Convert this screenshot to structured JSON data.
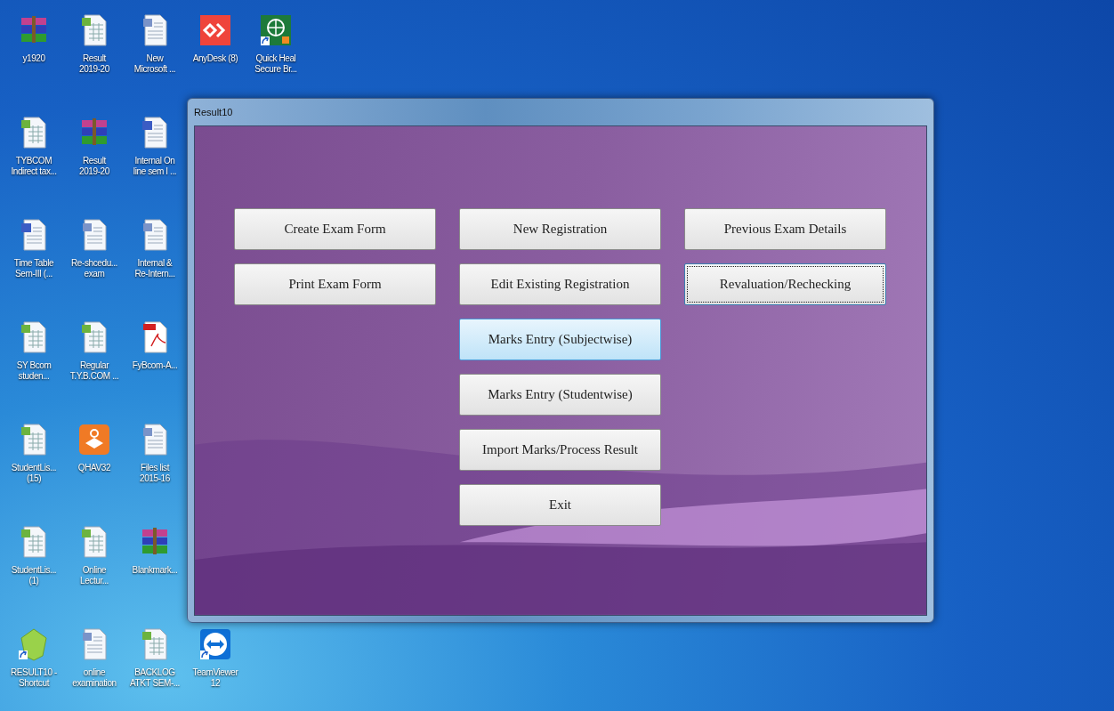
{
  "desktop_icons": [
    [
      {
        "label": "y1920",
        "kind": "archive",
        "shortcut": false
      },
      {
        "label": "Result\n2019-20",
        "kind": "excel",
        "shortcut": false
      },
      {
        "label": "New\nMicrosoft ...",
        "kind": "word-doc",
        "shortcut": false
      },
      {
        "label": "AnyDesk (8)",
        "kind": "anydesk",
        "shortcut": false
      },
      {
        "label": "Quick Heal\nSecure Br...",
        "kind": "globe",
        "shortcut": true
      }
    ],
    [
      {
        "label": "TYBCOM\nIndirect tax...",
        "kind": "excel",
        "shortcut": false
      },
      {
        "label": "Result\n2019-20",
        "kind": "archive",
        "shortcut": false
      },
      {
        "label": "Internal On\nline sem I ...",
        "kind": "word",
        "shortcut": false
      }
    ],
    [
      {
        "label": "Time Table\nSem-III (...",
        "kind": "word",
        "shortcut": false
      },
      {
        "label": "Re-shcedu...\nexam",
        "kind": "word-doc",
        "shortcut": false
      },
      {
        "label": "Internal &\nRe-Intern...",
        "kind": "word-doc",
        "shortcut": false
      }
    ],
    [
      {
        "label": "SY Bcom\nstuden...",
        "kind": "excel",
        "shortcut": false
      },
      {
        "label": "Regular\nT.Y.B.COM ...",
        "kind": "excel",
        "shortcut": false
      },
      {
        "label": "FyBcom-A...",
        "kind": "pdf",
        "shortcut": false
      }
    ],
    [
      {
        "label": "StudentLis...\n(15)",
        "kind": "excel",
        "shortcut": false
      },
      {
        "label": "QHAV32",
        "kind": "box",
        "shortcut": false
      },
      {
        "label": "Files list\n2015-16",
        "kind": "word-doc",
        "shortcut": false
      }
    ],
    [
      {
        "label": "StudentLis...\n(1)",
        "kind": "excel",
        "shortcut": false
      },
      {
        "label": "Online\nLectur...",
        "kind": "excel",
        "shortcut": false
      },
      {
        "label": "Blankmark...",
        "kind": "archive",
        "shortcut": false
      }
    ],
    [
      {
        "label": "RESULT10 -\nShortcut",
        "kind": "gem",
        "shortcut": true
      },
      {
        "label": "online\nexamination",
        "kind": "word-doc",
        "shortcut": false
      },
      {
        "label": "BACKLOG\nATKT SEM-...",
        "kind": "excel",
        "shortcut": false
      },
      {
        "label": "TeamViewer\n12",
        "kind": "teamviewer",
        "shortcut": true
      }
    ]
  ],
  "window": {
    "title": "Result10",
    "button_columns": [
      [
        {
          "label": "Create Exam Form",
          "hovered": false,
          "focused": false
        },
        {
          "label": "Print Exam Form",
          "hovered": false,
          "focused": false
        }
      ],
      [
        {
          "label": "New Registration",
          "hovered": false,
          "focused": false
        },
        {
          "label": "Edit Existing Registration",
          "hovered": false,
          "focused": false
        },
        {
          "label": "Marks Entry (Subjectwise)",
          "hovered": true,
          "focused": false
        },
        {
          "label": "Marks Entry (Studentwise)",
          "hovered": false,
          "focused": false
        },
        {
          "label": "Import Marks/Process Result",
          "hovered": false,
          "focused": false
        },
        {
          "label": "Exit",
          "hovered": false,
          "focused": false
        }
      ],
      [
        {
          "label": "Previous Exam Details",
          "hovered": false,
          "focused": false
        },
        {
          "label": "Revaluation/Rechecking",
          "hovered": false,
          "focused": true
        }
      ]
    ]
  }
}
